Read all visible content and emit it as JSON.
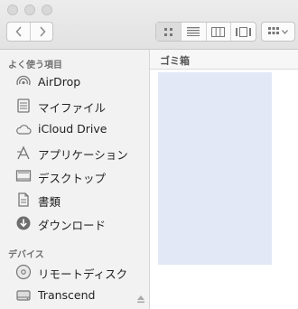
{
  "window": {
    "title_path": "ゴミ箱"
  },
  "toolbar": {
    "nav": {
      "back_icon": "chevron-left-icon",
      "forward_icon": "chevron-right-icon"
    },
    "view_modes": [
      "icon-view",
      "list-view",
      "column-view",
      "coverflow-view"
    ],
    "active_view": "icon-view",
    "arrange_icon": "arrange-grid-icon"
  },
  "sidebar": {
    "favorites_title": "よく使う項目",
    "favorites": [
      {
        "label": "AirDrop",
        "icon": "airdrop-icon"
      },
      {
        "label": "マイファイル",
        "icon": "all-my-files-icon"
      },
      {
        "label": "iCloud Drive",
        "icon": "cloud-icon"
      },
      {
        "label": "アプリケーション",
        "icon": "applications-icon"
      },
      {
        "label": "デスクトップ",
        "icon": "desktop-icon"
      },
      {
        "label": "書類",
        "icon": "documents-icon"
      },
      {
        "label": "ダウンロード",
        "icon": "download-icon"
      }
    ],
    "devices_title": "デバイス",
    "devices": [
      {
        "label": "リモートディスク",
        "icon": "disc-icon"
      },
      {
        "label": "Transcend",
        "icon": "drive-icon",
        "ejectable": true
      }
    ]
  },
  "colors": {
    "selection": "#e3e8f6",
    "sidebar_bg": "#f2f2f2"
  }
}
